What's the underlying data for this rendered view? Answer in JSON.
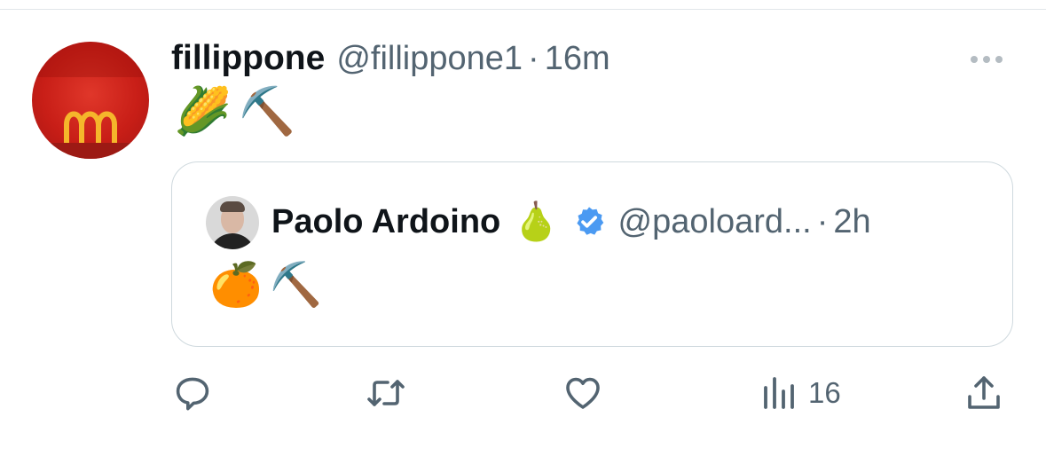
{
  "tweet": {
    "author": {
      "display_name": "fillippone",
      "handle": "@fillippone1"
    },
    "separator": "·",
    "time": "16m",
    "text_emojis": [
      "🌽",
      "⛏️"
    ],
    "more_label": "more-options"
  },
  "quote": {
    "author": {
      "display_name": "Paolo Ardoino",
      "name_emoji": "🍐",
      "handle": "@paoloard..."
    },
    "separator": "·",
    "time": "2h",
    "text_emojis": [
      "🍊",
      "⛏️"
    ],
    "verified_color": "#4b9af2"
  },
  "actions": {
    "reply": {
      "icon": "reply-icon"
    },
    "retweet": {
      "icon": "retweet-icon"
    },
    "like": {
      "icon": "heart-icon"
    },
    "views": {
      "icon": "views-icon",
      "count": "16"
    },
    "share": {
      "icon": "share-icon"
    }
  },
  "colors": {
    "text": "#0f1419",
    "muted": "#536471",
    "border": "#cfd9de"
  }
}
